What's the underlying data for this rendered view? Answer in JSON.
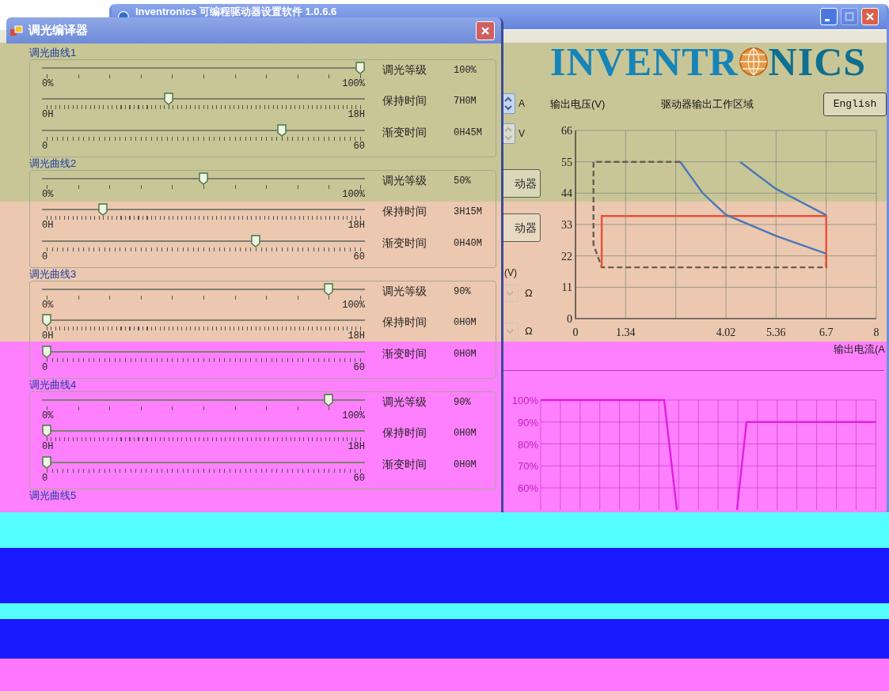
{
  "main_window": {
    "title": "Inventronics 可编程驱动器设置软件 1.0.6.6",
    "title_buttons": [
      {
        "kind": "minimize",
        "disabled": false
      },
      {
        "kind": "maximize",
        "disabled": true
      },
      {
        "kind": "close",
        "disabled": false
      }
    ],
    "controls": [
      {
        "kind": "spin",
        "unit": "A",
        "disabled": false
      },
      {
        "kind": "spin",
        "unit": "V",
        "disabled": true
      },
      {
        "kind": "button",
        "label": "动器"
      },
      {
        "kind": "button",
        "label": "动器"
      },
      {
        "kind": "label",
        "label": "(V)"
      },
      {
        "kind": "dropdown",
        "unit": "Ω"
      },
      {
        "kind": "dropdown",
        "unit": "Ω"
      }
    ],
    "logo": [
      "INVENTR",
      "NICS"
    ],
    "language_button": "English",
    "work_area_chart": {
      "chart_data": {
        "type": "line",
        "title": "驱动器输出工作区域",
        "xlabel": "输出电流(A",
        "ylabel": "输出电压(V)",
        "xlim": [
          0,
          8.04
        ],
        "ylim": [
          0,
          66
        ],
        "grid": true,
        "xticks": [
          0,
          1.34,
          4.02,
          5.36,
          6.7,
          {
            "value": 8.04,
            "label": "8"
          }
        ],
        "yticks": [
          0,
          11,
          22,
          33,
          44,
          55,
          66
        ],
        "series": [
          {
            "color": "#6b5d52",
            "line_style": "dashed",
            "x": [
              2.8,
              0.48,
              0.48,
              0.7,
              6.7,
              6.7
            ],
            "values": [
              55,
              55,
              26,
              18,
              18,
              22
            ]
          },
          {
            "color": "#e8503a",
            "line_style": "solid",
            "x": [
              0.7,
              0.7,
              6.7,
              6.7
            ],
            "values": [
              18,
              36,
              36,
              18
            ]
          },
          {
            "color": "#4a78b8",
            "line_style": "solid",
            "x": [
              2.8,
              3.4,
              4.02,
              5.36,
              6.7
            ],
            "values": [
              55,
              44,
              36.4,
              29,
              22.8
            ]
          },
          {
            "color": "#4a78b8",
            "line_style": "solid",
            "x": [
              4.4,
              4.9,
              5.36,
              6.7
            ],
            "values": [
              55,
              50,
              45.5,
              36.3
            ]
          }
        ]
      }
    },
    "dimming_chart": {
      "y_labels": [
        "100%",
        "90%",
        "80%",
        "70%",
        "60%"
      ]
    }
  },
  "dialog": {
    "title": "调光编译器",
    "curves": [
      {
        "title": "调光曲线1",
        "sliders": [
          {
            "kind": "percent",
            "label": "调光等级",
            "value": "100%",
            "min": "0%",
            "max": "100%",
            "level": 1
          },
          {
            "kind": "hours",
            "label": "保持时间",
            "value": "7H0M",
            "min": "0H",
            "max": "18H",
            "level": 0.39
          },
          {
            "kind": "minutes",
            "label": "渐变时间",
            "value": "0H45M",
            "min": "0",
            "max": "60",
            "level": 0.75
          }
        ]
      },
      {
        "title": "调光曲线2",
        "sliders": [
          {
            "kind": "percent",
            "label": "调光等级",
            "value": "50%",
            "min": "0%",
            "max": "100%",
            "level": 0.5
          },
          {
            "kind": "hours",
            "label": "保持时间",
            "value": "3H15M",
            "min": "0H",
            "max": "18H",
            "level": 0.18
          },
          {
            "kind": "minutes",
            "label": "渐变时间",
            "value": "0H40M",
            "min": "0",
            "max": "60",
            "level": 0.667
          }
        ]
      },
      {
        "title": "调光曲线3",
        "sliders": [
          {
            "kind": "percent",
            "label": "调光等级",
            "value": "90%",
            "min": "0%",
            "max": "100%",
            "level": 0.9
          },
          {
            "kind": "hours",
            "label": "保持时间",
            "value": "0H0M",
            "min": "0H",
            "max": "18H",
            "level": 0
          },
          {
            "kind": "minutes",
            "label": "渐变时间",
            "value": "0H0M",
            "min": "0",
            "max": "60",
            "level": 0
          }
        ]
      },
      {
        "title": "调光曲线4",
        "sliders": [
          {
            "kind": "percent",
            "label": "调光等级",
            "value": "90%",
            "min": "0%",
            "max": "100%",
            "level": 0.9
          },
          {
            "kind": "hours",
            "label": "保持时间",
            "value": "0H0M",
            "min": "0H",
            "max": "18H",
            "level": 0
          },
          {
            "kind": "minutes",
            "label": "渐变时间",
            "value": "0H0M",
            "min": "0",
            "max": "60",
            "level": 0
          }
        ]
      },
      {
        "title": "调光曲线5"
      }
    ]
  }
}
